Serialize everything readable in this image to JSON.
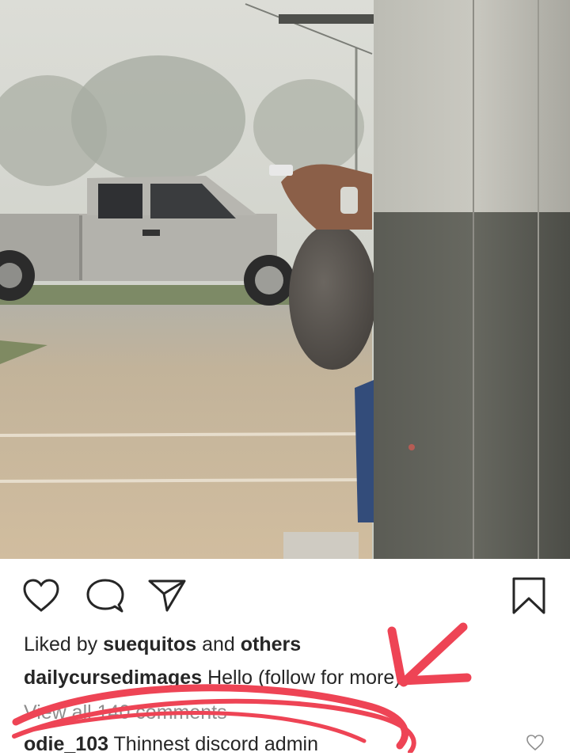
{
  "post": {
    "photo_alt": "",
    "likes": {
      "prefix": "Liked by",
      "user": "suequitos",
      "conjunction": "and",
      "others": "others"
    },
    "caption": {
      "username": "dailycursedimages",
      "text": "Hello (follow for more)"
    },
    "view_comments": "View all 140 comments",
    "comment": {
      "username": "odie_103",
      "text": "Thinnest discord admin"
    }
  },
  "icons": {
    "like": "heart-icon",
    "comment": "comment-bubble-icon",
    "share": "paper-plane-icon",
    "save": "bookmark-icon",
    "comment_like": "small-heart-icon"
  },
  "colors": {
    "text": "#262626",
    "muted": "#8e8e8e",
    "annotation": "#ee4455"
  }
}
